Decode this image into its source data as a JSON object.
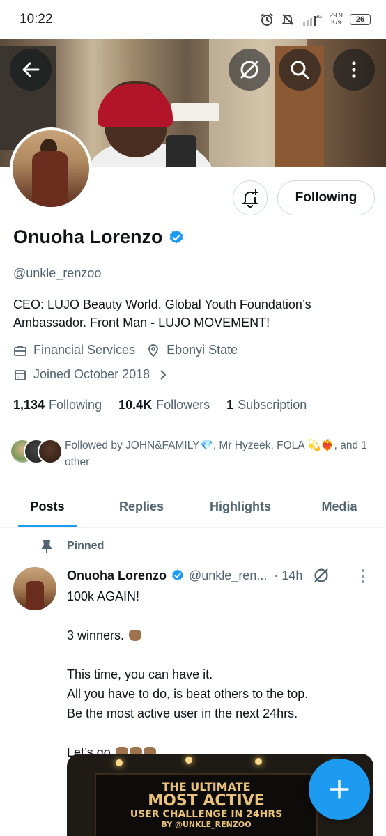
{
  "status_bar": {
    "time": "10:22",
    "net_speed_top": "29.9",
    "net_speed_bottom": "K/s",
    "battery": "26"
  },
  "profile": {
    "name": "Onuoha Lorenzo",
    "handle": "@unkle_renzoo",
    "bio": "CEO: LUJO Beauty World. Global Youth Foundation’s Ambassador. Front Man - LUJO MOVEMENT!",
    "category": "Financial Services",
    "location": "Ebonyi State",
    "joined": "Joined October 2018",
    "following_count": "1,134",
    "following_label": "Following",
    "followers_count": "10.4K",
    "followers_label": "Followers",
    "subscription_count": "1",
    "subscription_label": "Subscription",
    "followed_by": "Followed by JOHN&FAMILY💎, Mr Hyzeek, FOLA 💫❤️‍🔥, and 1 other",
    "follow_button": "Following",
    "verified_color": "#1d9bf0"
  },
  "tabs": [
    {
      "label": "Posts",
      "active": true
    },
    {
      "label": "Replies",
      "active": false
    },
    {
      "label": "Highlights",
      "active": false
    },
    {
      "label": "Media",
      "active": false
    }
  ],
  "pinned_tweet": {
    "pinned_label": "Pinned",
    "author_name": "Onuoha Lorenzo",
    "author_handle": "@unkle_ren...",
    "time": "· 14h",
    "lines": [
      "100k AGAIN!",
      "",
      "3 winners.",
      "",
      "This time, you can have it.",
      "All you have to do, is beat others to the top.",
      "Be the most active user in the next 24hrs.",
      "",
      "Let’s go"
    ],
    "media_text": {
      "line1": "THE ULTIMATE",
      "line2": "MOST ACTIVE",
      "line3": "USER CHALLENGE IN 24HRS",
      "line4": "BY @UNKLE_RENZOO"
    }
  },
  "colors": {
    "accent": "#1d9bf0",
    "text_primary": "#0f1419",
    "text_secondary": "#536471"
  }
}
